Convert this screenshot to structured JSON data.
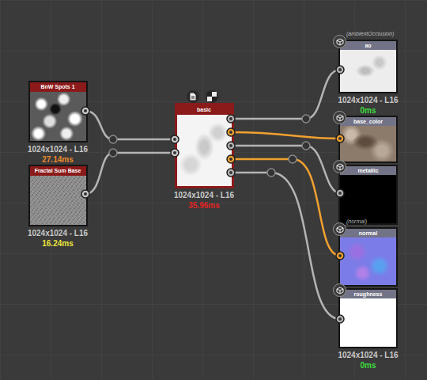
{
  "nodes": [
    {
      "title": "BnW Spots 1",
      "resolution": "1024x1024 - L16",
      "time": "27.14ms",
      "color": "#e8892e",
      "preview": "spots"
    },
    {
      "title": "Fractal Sum Base",
      "resolution": "1024x1024 - L16",
      "time": "16.24ms",
      "color": "#e8e43a",
      "preview": "noise"
    },
    {
      "title": "basic",
      "resolution": "1024x1024 - L16",
      "time": "35.96ms",
      "color": "#e02424",
      "preview": "basic"
    }
  ],
  "outputs": [
    {
      "label": "ao",
      "sublabel": "(ambientOcclusion)",
      "preview": "ao",
      "color": "#b4b4b4",
      "footer": {
        "resolution": "1024x1024 - L16",
        "time": "0ms",
        "time_color": "#3cdc3c"
      }
    },
    {
      "label": "base_color",
      "sublabel": "",
      "preview": "base",
      "color": "#f0a030",
      "footer": null
    },
    {
      "label": "metallic",
      "sublabel": "",
      "preview": "metal",
      "color": "#b4b4b4",
      "footer": null
    },
    {
      "label": "normal",
      "sublabel": "(normal)",
      "preview": "normal",
      "color": "#f0a030",
      "footer": null
    },
    {
      "label": "roughness",
      "sublabel": "",
      "preview": "rough",
      "color": "#b4b4b4",
      "footer": {
        "resolution": "1024x1024 - L16",
        "time": "0ms",
        "time_color": "#3cdc3c"
      }
    }
  ]
}
